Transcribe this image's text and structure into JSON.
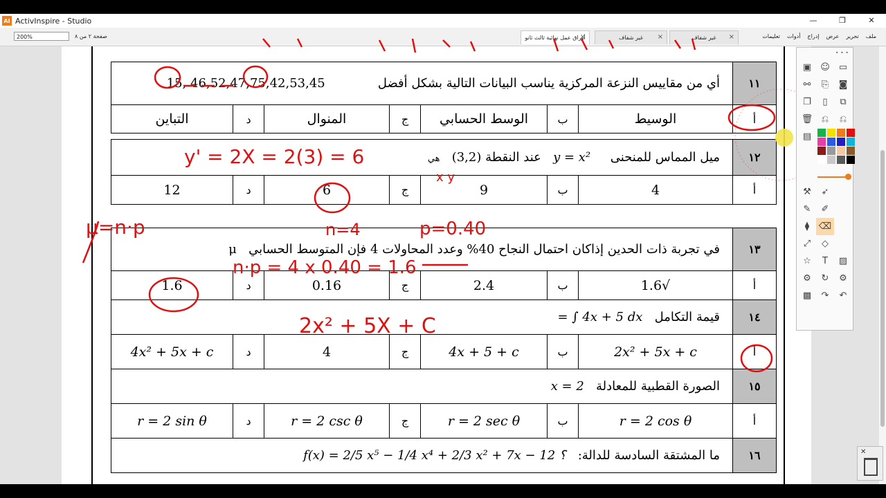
{
  "app": {
    "title": "ActivInspire - Studio",
    "icon_label": "AI",
    "minimize": "—",
    "maximize": "❐",
    "close": "✕"
  },
  "toolbar": {
    "zoom": "200%",
    "page_info": "صفحة ٢ من ٨",
    "tabs": [
      {
        "label": "أوراق عمل نهائية ثالث ثانو",
        "active": true
      },
      {
        "label": "غير شفاف",
        "active": false
      },
      {
        "label": "غير شفاف",
        "active": false
      }
    ],
    "menu": [
      "ملف",
      "تحرير",
      "عرض",
      "إدراج",
      "أدوات",
      "تعليمات"
    ]
  },
  "questions": {
    "q11": {
      "num": "١١",
      "text": "أي من مقاييس النزعة المركزية يناسب البيانات التالية بشكل أفضل",
      "data": "15, 46,52,47,75,42,53,45",
      "options": [
        {
          "letter": "أ",
          "value": "الوسيط"
        },
        {
          "letter": "ب",
          "value": "الوسط الحسابي"
        },
        {
          "letter": "ج",
          "value": "المنوال"
        },
        {
          "letter": "د",
          "value": "التباين"
        }
      ]
    },
    "q12": {
      "num": "١٢",
      "text": "ميل المماس للمنحنى",
      "equation": "y = x²",
      "point_text": "عند النقطة (3,2)",
      "suffix": "هي",
      "options": [
        {
          "letter": "أ",
          "value": "4"
        },
        {
          "letter": "ب",
          "value": "9"
        },
        {
          "letter": "ج",
          "value": "6"
        },
        {
          "letter": "د",
          "value": "12"
        }
      ]
    },
    "q13": {
      "num": "١٣",
      "text": "في تجربة ذات الحدين إذاكان احتمال النجاح 40% وعدد المحاولات 4 فإن المتوسط الحسابي",
      "symbol": "μ",
      "options": [
        {
          "letter": "أ",
          "value": "√1.6"
        },
        {
          "letter": "ب",
          "value": "2.4"
        },
        {
          "letter": "ج",
          "value": "0.16"
        },
        {
          "letter": "د",
          "value": "1.6"
        }
      ]
    },
    "q14": {
      "num": "١٤",
      "text": "قيمة التكامل",
      "expr": "= ∫ 4x + 5 dx",
      "options": [
        {
          "letter": "أ",
          "value": "2x² + 5x + c"
        },
        {
          "letter": "ب",
          "value": "4x + 5 + c"
        },
        {
          "letter": "ج",
          "value": "4"
        },
        {
          "letter": "د",
          "value": "4x² + 5x + c"
        }
      ]
    },
    "q15": {
      "num": "١٥",
      "text": "الصورة القطبية للمعادلة",
      "equation": "x = 2",
      "options": [
        {
          "letter": "أ",
          "value": "r = 2 cos θ"
        },
        {
          "letter": "ب",
          "value": "r = 2 sec θ"
        },
        {
          "letter": "ج",
          "value": "r = 2 csc θ"
        },
        {
          "letter": "د",
          "value": "r = 2 sin θ"
        }
      ]
    },
    "q16": {
      "num": "١٦",
      "text": "ما المشتقة السادسة للدالة:",
      "equation": "f(x) = 2/5 x⁵ − 1/4 x⁴ + 2/3 x² + 7x − 12 ؟"
    }
  },
  "annotations": {
    "q12_work": "y' = 2X = 2(3) = 6",
    "q12_xy": "x y",
    "mu_formula": "μ=n·p",
    "n_value": "n=4",
    "p_value": "p=0.40",
    "q13_work": "n·p = 4 x 0.40 = 1.6",
    "q14_work": "2x² + 5X + C"
  },
  "colors": {
    "ink": "#e01010",
    "accent": "#f07b1a",
    "header_cell": "#bfbfbf"
  },
  "swatches": [
    "#17b34a",
    "#f5e000",
    "#f07b1a",
    "#e01010",
    "#e83ea8",
    "#2d5be3",
    "#2020c0",
    "#12b3d8",
    "#8b1a1a",
    "#9a9a9a",
    "#f4c9a0",
    "#8b5a2b",
    "#ffffff",
    "#c8c8c8",
    "#5a5a5a",
    "#000000"
  ]
}
